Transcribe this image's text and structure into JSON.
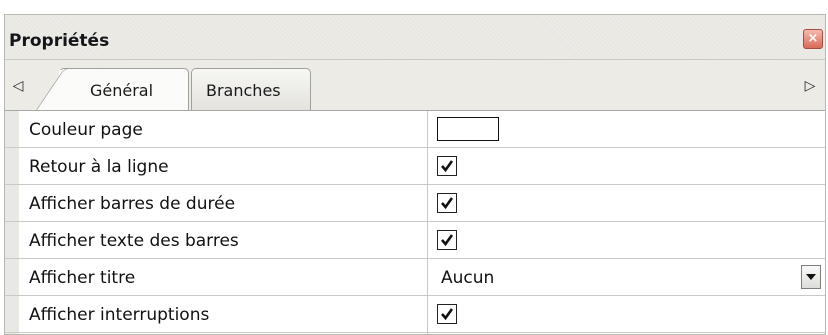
{
  "panel": {
    "title": "Propriétés",
    "close_symbol": "×"
  },
  "tabs": {
    "scroll_left": "◁",
    "scroll_right": "▷",
    "items": [
      {
        "label": "Général",
        "active": true
      },
      {
        "label": "Branches",
        "active": false
      }
    ]
  },
  "properties": [
    {
      "label": "Couleur page",
      "type": "color",
      "value": "#ffffff"
    },
    {
      "label": "Retour à la ligne",
      "type": "checkbox",
      "checked": true
    },
    {
      "label": "Afficher barres de durée",
      "type": "checkbox",
      "checked": true
    },
    {
      "label": "Afficher texte des barres",
      "type": "checkbox",
      "checked": true
    },
    {
      "label": "Afficher titre",
      "type": "select",
      "value": "Aucun"
    },
    {
      "label": "Afficher interruptions",
      "type": "checkbox",
      "checked": true
    }
  ],
  "icons": {
    "close": "close-icon",
    "scroll_left": "triangle-left-icon",
    "scroll_right": "triangle-right-icon",
    "dropdown": "dropdown-arrow-icon",
    "check": "checkmark-icon"
  }
}
